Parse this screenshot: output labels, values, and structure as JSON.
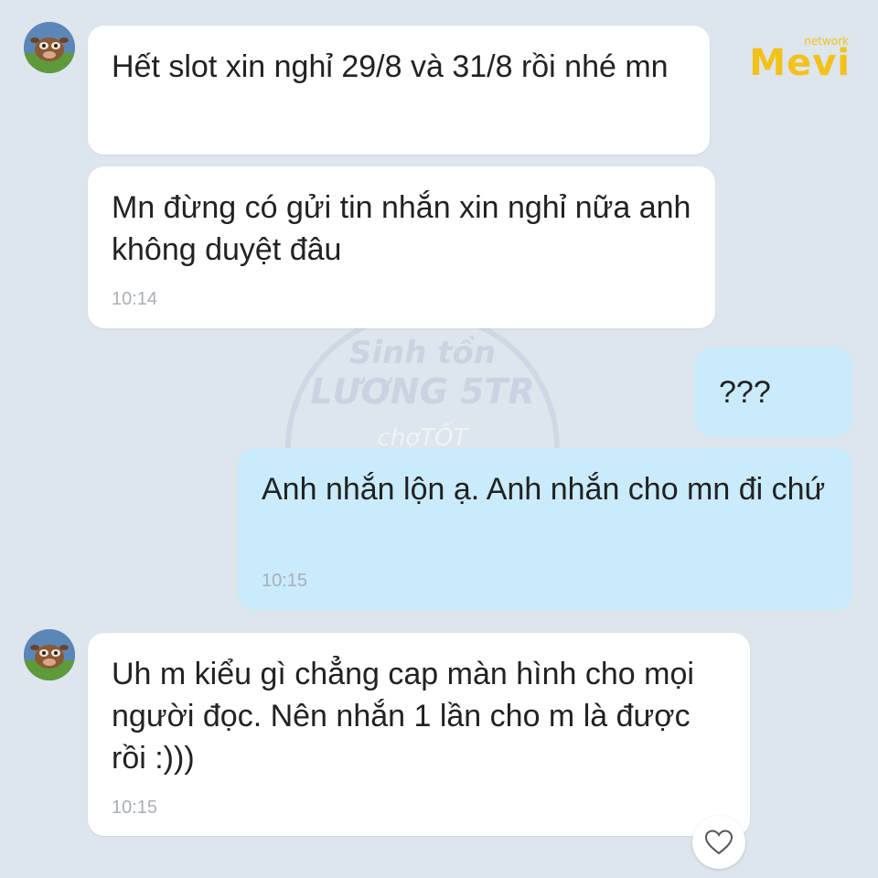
{
  "brand": {
    "small": "network",
    "name": "Mevi"
  },
  "watermark": {
    "line1": "Sinh tồn",
    "line2": "LƯƠNG 5TR",
    "line3": "chợTỐT"
  },
  "messages": [
    {
      "direction": "in",
      "text": "Hết slot xin nghỉ 29/8 và 31/8 rồi nhé mn",
      "time": ""
    },
    {
      "direction": "in",
      "text": "Mn đừng có gửi tin nhắn xin nghỉ nữa anh không duyệt đâu",
      "time": "10:14"
    },
    {
      "direction": "out",
      "text": "???",
      "time": ""
    },
    {
      "direction": "out",
      "text": "Anh nhắn lộn ạ. Anh nhắn cho mn đi chứ",
      "time": "10:15"
    },
    {
      "direction": "in",
      "text": "Uh m kiểu gì chẳng cap màn hình cho mọi người đọc. Nên nhắn 1 lần cho m là được rồi :)))",
      "time": "10:15"
    }
  ],
  "icons": {
    "like": "heart-icon",
    "avatar": "avatar-icon"
  },
  "colors": {
    "background": "#dde5ed",
    "incoming_bubble": "#ffffff",
    "outgoing_bubble": "#c9ebfb",
    "brand": "#f2c21a",
    "timestamp": "#a9afb6"
  }
}
